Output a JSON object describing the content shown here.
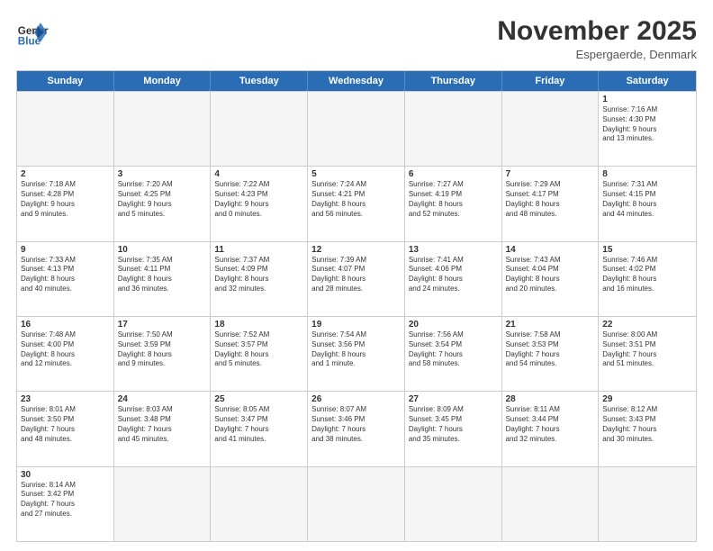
{
  "header": {
    "logo_general": "General",
    "logo_blue": "Blue",
    "month_year": "November 2025",
    "location": "Espergaerde, Denmark"
  },
  "days_of_week": [
    "Sunday",
    "Monday",
    "Tuesday",
    "Wednesday",
    "Thursday",
    "Friday",
    "Saturday"
  ],
  "weeks": [
    [
      {
        "day": "",
        "info": "",
        "empty": true
      },
      {
        "day": "",
        "info": "",
        "empty": true
      },
      {
        "day": "",
        "info": "",
        "empty": true
      },
      {
        "day": "",
        "info": "",
        "empty": true
      },
      {
        "day": "",
        "info": "",
        "empty": true
      },
      {
        "day": "",
        "info": "",
        "empty": true
      },
      {
        "day": "1",
        "info": "Sunrise: 7:16 AM\nSunset: 4:30 PM\nDaylight: 9 hours\nand 13 minutes.",
        "empty": false
      }
    ],
    [
      {
        "day": "2",
        "info": "Sunrise: 7:18 AM\nSunset: 4:28 PM\nDaylight: 9 hours\nand 9 minutes.",
        "empty": false
      },
      {
        "day": "3",
        "info": "Sunrise: 7:20 AM\nSunset: 4:25 PM\nDaylight: 9 hours\nand 5 minutes.",
        "empty": false
      },
      {
        "day": "4",
        "info": "Sunrise: 7:22 AM\nSunset: 4:23 PM\nDaylight: 9 hours\nand 0 minutes.",
        "empty": false
      },
      {
        "day": "5",
        "info": "Sunrise: 7:24 AM\nSunset: 4:21 PM\nDaylight: 8 hours\nand 56 minutes.",
        "empty": false
      },
      {
        "day": "6",
        "info": "Sunrise: 7:27 AM\nSunset: 4:19 PM\nDaylight: 8 hours\nand 52 minutes.",
        "empty": false
      },
      {
        "day": "7",
        "info": "Sunrise: 7:29 AM\nSunset: 4:17 PM\nDaylight: 8 hours\nand 48 minutes.",
        "empty": false
      },
      {
        "day": "8",
        "info": "Sunrise: 7:31 AM\nSunset: 4:15 PM\nDaylight: 8 hours\nand 44 minutes.",
        "empty": false
      }
    ],
    [
      {
        "day": "9",
        "info": "Sunrise: 7:33 AM\nSunset: 4:13 PM\nDaylight: 8 hours\nand 40 minutes.",
        "empty": false
      },
      {
        "day": "10",
        "info": "Sunrise: 7:35 AM\nSunset: 4:11 PM\nDaylight: 8 hours\nand 36 minutes.",
        "empty": false
      },
      {
        "day": "11",
        "info": "Sunrise: 7:37 AM\nSunset: 4:09 PM\nDaylight: 8 hours\nand 32 minutes.",
        "empty": false
      },
      {
        "day": "12",
        "info": "Sunrise: 7:39 AM\nSunset: 4:07 PM\nDaylight: 8 hours\nand 28 minutes.",
        "empty": false
      },
      {
        "day": "13",
        "info": "Sunrise: 7:41 AM\nSunset: 4:06 PM\nDaylight: 8 hours\nand 24 minutes.",
        "empty": false
      },
      {
        "day": "14",
        "info": "Sunrise: 7:43 AM\nSunset: 4:04 PM\nDaylight: 8 hours\nand 20 minutes.",
        "empty": false
      },
      {
        "day": "15",
        "info": "Sunrise: 7:46 AM\nSunset: 4:02 PM\nDaylight: 8 hours\nand 16 minutes.",
        "empty": false
      }
    ],
    [
      {
        "day": "16",
        "info": "Sunrise: 7:48 AM\nSunset: 4:00 PM\nDaylight: 8 hours\nand 12 minutes.",
        "empty": false
      },
      {
        "day": "17",
        "info": "Sunrise: 7:50 AM\nSunset: 3:59 PM\nDaylight: 8 hours\nand 9 minutes.",
        "empty": false
      },
      {
        "day": "18",
        "info": "Sunrise: 7:52 AM\nSunset: 3:57 PM\nDaylight: 8 hours\nand 5 minutes.",
        "empty": false
      },
      {
        "day": "19",
        "info": "Sunrise: 7:54 AM\nSunset: 3:56 PM\nDaylight: 8 hours\nand 1 minute.",
        "empty": false
      },
      {
        "day": "20",
        "info": "Sunrise: 7:56 AM\nSunset: 3:54 PM\nDaylight: 7 hours\nand 58 minutes.",
        "empty": false
      },
      {
        "day": "21",
        "info": "Sunrise: 7:58 AM\nSunset: 3:53 PM\nDaylight: 7 hours\nand 54 minutes.",
        "empty": false
      },
      {
        "day": "22",
        "info": "Sunrise: 8:00 AM\nSunset: 3:51 PM\nDaylight: 7 hours\nand 51 minutes.",
        "empty": false
      }
    ],
    [
      {
        "day": "23",
        "info": "Sunrise: 8:01 AM\nSunset: 3:50 PM\nDaylight: 7 hours\nand 48 minutes.",
        "empty": false
      },
      {
        "day": "24",
        "info": "Sunrise: 8:03 AM\nSunset: 3:48 PM\nDaylight: 7 hours\nand 45 minutes.",
        "empty": false
      },
      {
        "day": "25",
        "info": "Sunrise: 8:05 AM\nSunset: 3:47 PM\nDaylight: 7 hours\nand 41 minutes.",
        "empty": false
      },
      {
        "day": "26",
        "info": "Sunrise: 8:07 AM\nSunset: 3:46 PM\nDaylight: 7 hours\nand 38 minutes.",
        "empty": false
      },
      {
        "day": "27",
        "info": "Sunrise: 8:09 AM\nSunset: 3:45 PM\nDaylight: 7 hours\nand 35 minutes.",
        "empty": false
      },
      {
        "day": "28",
        "info": "Sunrise: 8:11 AM\nSunset: 3:44 PM\nDaylight: 7 hours\nand 32 minutes.",
        "empty": false
      },
      {
        "day": "29",
        "info": "Sunrise: 8:12 AM\nSunset: 3:43 PM\nDaylight: 7 hours\nand 30 minutes.",
        "empty": false
      }
    ],
    [
      {
        "day": "30",
        "info": "Sunrise: 8:14 AM\nSunset: 3:42 PM\nDaylight: 7 hours\nand 27 minutes.",
        "empty": false
      },
      {
        "day": "",
        "info": "",
        "empty": true
      },
      {
        "day": "",
        "info": "",
        "empty": true
      },
      {
        "day": "",
        "info": "",
        "empty": true
      },
      {
        "day": "",
        "info": "",
        "empty": true
      },
      {
        "day": "",
        "info": "",
        "empty": true
      },
      {
        "day": "",
        "info": "",
        "empty": true
      }
    ]
  ]
}
